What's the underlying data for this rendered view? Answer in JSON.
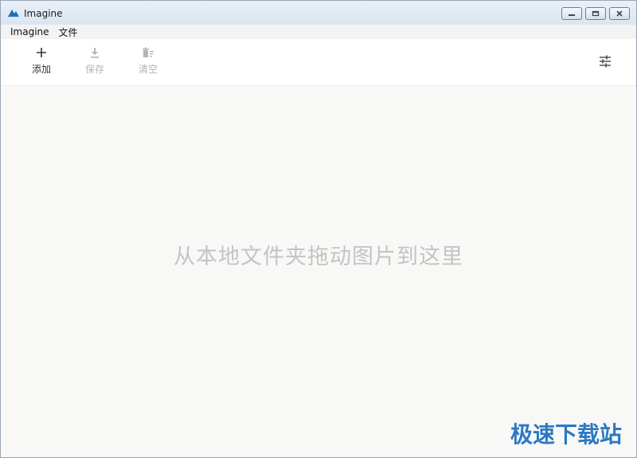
{
  "window": {
    "title": "Imagine"
  },
  "menu": {
    "items": [
      "Imagine",
      "文件"
    ]
  },
  "toolbar": {
    "add_label": "添加",
    "save_label": "保存",
    "clear_label": "清空"
  },
  "content": {
    "drop_hint": "从本地文件夹拖动图片到这里"
  },
  "watermark": {
    "text": "极速下载站"
  },
  "icons": {
    "app": "mountain-icon",
    "add": "plus-icon",
    "save": "download-icon",
    "clear": "trash-icon",
    "settings": "sliders-icon"
  },
  "colors": {
    "accent": "#1f6fbf",
    "disabled": "#b3b3b3",
    "hint": "#c4c4c4",
    "watermark": "#2c79c2"
  }
}
